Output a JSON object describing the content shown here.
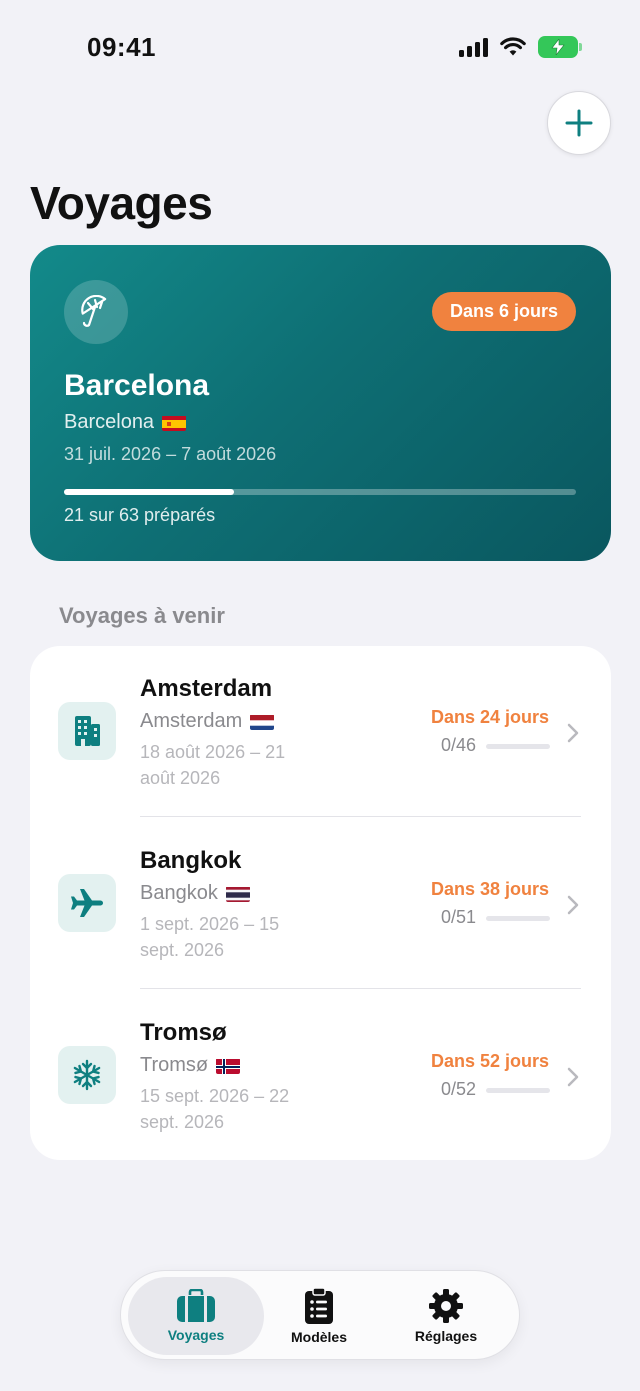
{
  "status_bar": {
    "time": "09:41"
  },
  "header": {
    "title": "Voyages"
  },
  "featured_trip": {
    "badge": "Dans 6 jours",
    "title": "Barcelona",
    "city": "Barcelona",
    "country_flag": "flag-spain",
    "dates": "31 juil. 2026 – 7 août 2026",
    "progress_fraction": 0.333,
    "progress_text": "21 sur 63 préparés",
    "icon": "umbrella-icon",
    "gradient_colors": [
      "#138a8a",
      "#0a575f"
    ],
    "badge_color": "#f0823f"
  },
  "upcoming": {
    "section_title": "Voyages à venir",
    "trips": [
      {
        "title": "Amsterdam",
        "city": "Amsterdam",
        "country_flag": "flag-netherlands",
        "dates": "18 août 2026 – 21 août 2026",
        "countdown": "Dans 24 jours",
        "count": "0/46",
        "icon": "building-icon",
        "progress_fraction": 0
      },
      {
        "title": "Bangkok",
        "city": "Bangkok",
        "country_flag": "flag-thailand",
        "dates": "1 sept. 2026 – 15 sept. 2026",
        "countdown": "Dans 38 jours",
        "count": "0/51",
        "icon": "airplane-icon",
        "progress_fraction": 0
      },
      {
        "title": "Tromsø",
        "city": "Tromsø",
        "country_flag": "flag-norway",
        "dates": "15 sept. 2026 – 22 sept. 2026",
        "countdown": "Dans 52 jours",
        "count": "0/52",
        "icon": "snowflake-icon",
        "progress_fraction": 0
      }
    ]
  },
  "tab_bar": {
    "tabs": [
      {
        "label": "Voyages",
        "icon": "suitcase-icon",
        "active": true
      },
      {
        "label": "Modèles",
        "icon": "checklist-icon",
        "active": false
      },
      {
        "label": "Réglages",
        "icon": "gear-icon",
        "active": false
      }
    ]
  },
  "colors": {
    "accent": "#0e7f80",
    "countdown": "#f0823f",
    "background": "#f2f2f7"
  }
}
